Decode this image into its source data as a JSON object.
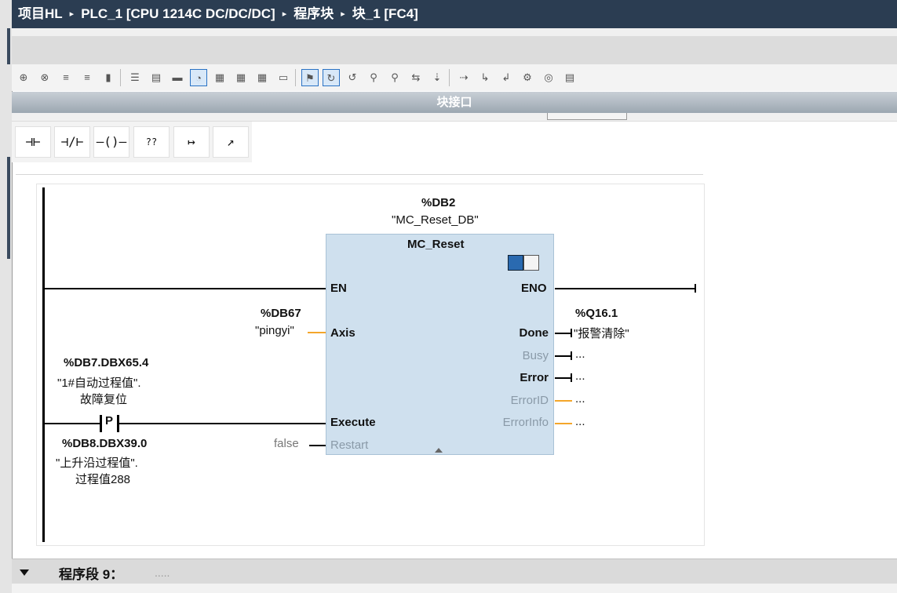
{
  "breadcrumb": {
    "items": [
      "项目HL",
      "PLC_1 [CPU 1214C DC/DC/DC]",
      "程序块",
      "块_1 [FC4]"
    ],
    "separator": "▸"
  },
  "toolbar": {
    "icons": [
      "insert-network-icon",
      "delete-network-icon",
      "insert-row-icon",
      "add-row-icon",
      "variable-icon",
      "absolute-address-icon",
      "symbolic-address-icon",
      "favorites-icon",
      "comment-icon",
      "open-all-icon",
      "close-all-icon",
      "go-to-icon",
      "sort-icon",
      "display-mode-icon",
      "monitor-icon",
      "go-to-next-icon",
      "go-to-prev-icon",
      "call-icon",
      "update-icon",
      "program-status-icon",
      "compare-icon",
      "watch-icon",
      "modify-icon",
      "step-icon",
      "breakpoint-icon",
      "db-icon"
    ]
  },
  "block_interface": {
    "label": "块接口"
  },
  "palette": {
    "items": [
      {
        "name": "no-contact-icon",
        "glyph": "⊣⊢"
      },
      {
        "name": "nc-contact-icon",
        "glyph": "⊣/⊢"
      },
      {
        "name": "coil-icon",
        "glyph": "–()–"
      },
      {
        "name": "empty-box-icon",
        "glyph": "??"
      },
      {
        "name": "open-branch-icon",
        "glyph": "↦"
      },
      {
        "name": "close-branch-icon",
        "glyph": "↗"
      }
    ]
  },
  "network": {
    "instance_db": {
      "address": "%DB2",
      "name": "\"MC_Reset_DB\""
    },
    "function_block": {
      "title": "MC_Reset",
      "inputs": {
        "en": "EN",
        "axis": "Axis",
        "execute": "Execute",
        "restart": "Restart"
      },
      "outputs": {
        "eno": "ENO",
        "done": "Done",
        "busy": "Busy",
        "error": "Error",
        "error_id": "ErrorID",
        "error_info": "ErrorInfo"
      }
    },
    "axis_param": {
      "address": "%DB67",
      "name": "\"pingyi\""
    },
    "execute_contact": {
      "address": "%DB7.DBX65.4",
      "name_line1": "\"1#自动过程值\".",
      "name_line2": "故障复位",
      "type": "P",
      "edge_address": "%DB8.DBX39.0",
      "edge_name_line1": "\"上升沿过程值\".",
      "edge_name_line2": "过程值288"
    },
    "restart_param": {
      "value": "false"
    },
    "done_output": {
      "address": "%Q16.1",
      "name": "\"报警清除\""
    },
    "busy_output": "...",
    "error_output": "...",
    "error_id_output": "...",
    "error_info_output": "..."
  },
  "segment": {
    "label": "程序段 9：",
    "comment": "....."
  },
  "colors": {
    "title_bar": "#2b3d52",
    "teal": "#2aa4a4",
    "fb_fill": "#cfe0ee",
    "orange_wire": "#f4a62a"
  }
}
